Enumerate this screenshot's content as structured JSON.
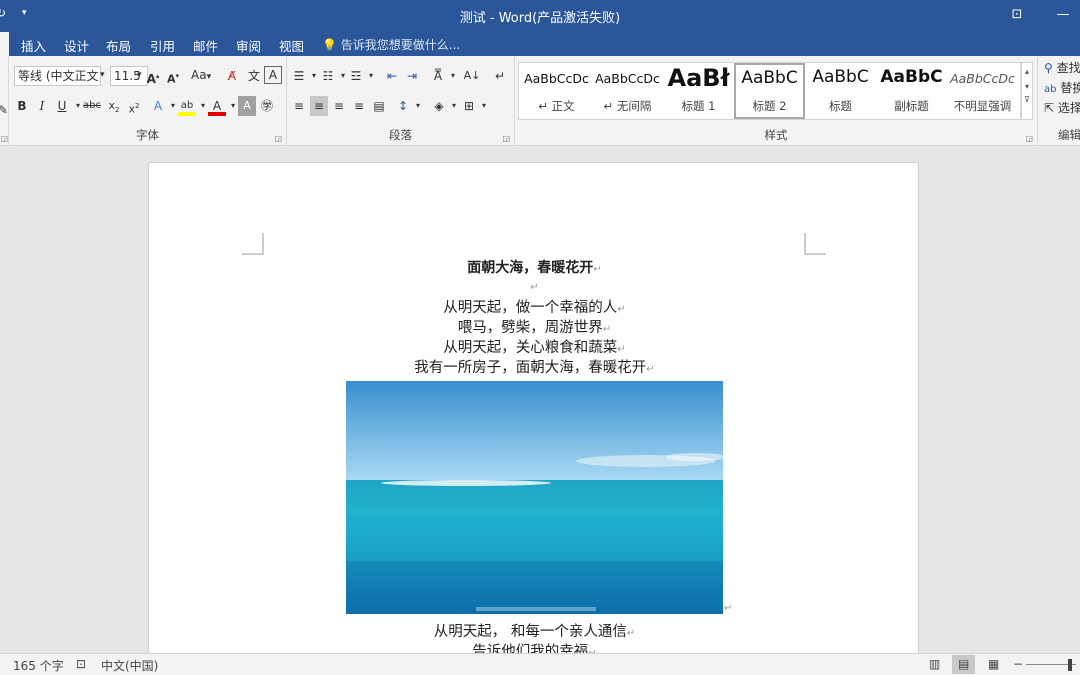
{
  "window": {
    "title": "测试 - Word(产品激活失败)"
  },
  "tabs": [
    {
      "label": "插入"
    },
    {
      "label": "设计"
    },
    {
      "label": "布局"
    },
    {
      "label": "引用"
    },
    {
      "label": "邮件"
    },
    {
      "label": "审阅"
    },
    {
      "label": "视图"
    }
  ],
  "tell_me": {
    "placeholder": "告诉我您想要做什么..."
  },
  "font": {
    "name": "等线 (中文正文",
    "size": "11.5",
    "change_case": "Aa",
    "group_label": "字体"
  },
  "paragraph": {
    "group_label": "段落"
  },
  "styles": {
    "group_label": "样式",
    "items": [
      {
        "preview": "AaBbCcDc",
        "name": "↵ 正文"
      },
      {
        "preview": "AaBbCcDc",
        "name": "↵ 无间隔"
      },
      {
        "preview": "AaBł",
        "name": "标题 1"
      },
      {
        "preview": "AaBbC",
        "name": "标题 2"
      },
      {
        "preview": "AaBbC",
        "name": "标题"
      },
      {
        "preview": "AaBbC",
        "name": "副标题"
      },
      {
        "preview": "AaBbCcDc",
        "name": "不明显强调"
      }
    ]
  },
  "editing": {
    "group_label": "编辑",
    "find": "查找",
    "replace": "替换",
    "select": "选择"
  },
  "document": {
    "title_line": "面朝大海，春暖花开",
    "lines": [
      "从明天起，做一个幸福的人",
      "喂马，劈柴，周游世界",
      "从明天起，关心粮食和蔬菜",
      "我有一所房子，面朝大海，春暖花开"
    ],
    "after_image_lines": [
      "从明天起， 和每一个亲人通信",
      "告诉他们我的幸福"
    ],
    "paragraph_mark": "↵"
  },
  "status": {
    "word_count": "165 个字",
    "language": "中文(中国)"
  },
  "colors": {
    "accent": "#2b579a",
    "highlight": "#ffff00",
    "font_color": "#e00000"
  }
}
